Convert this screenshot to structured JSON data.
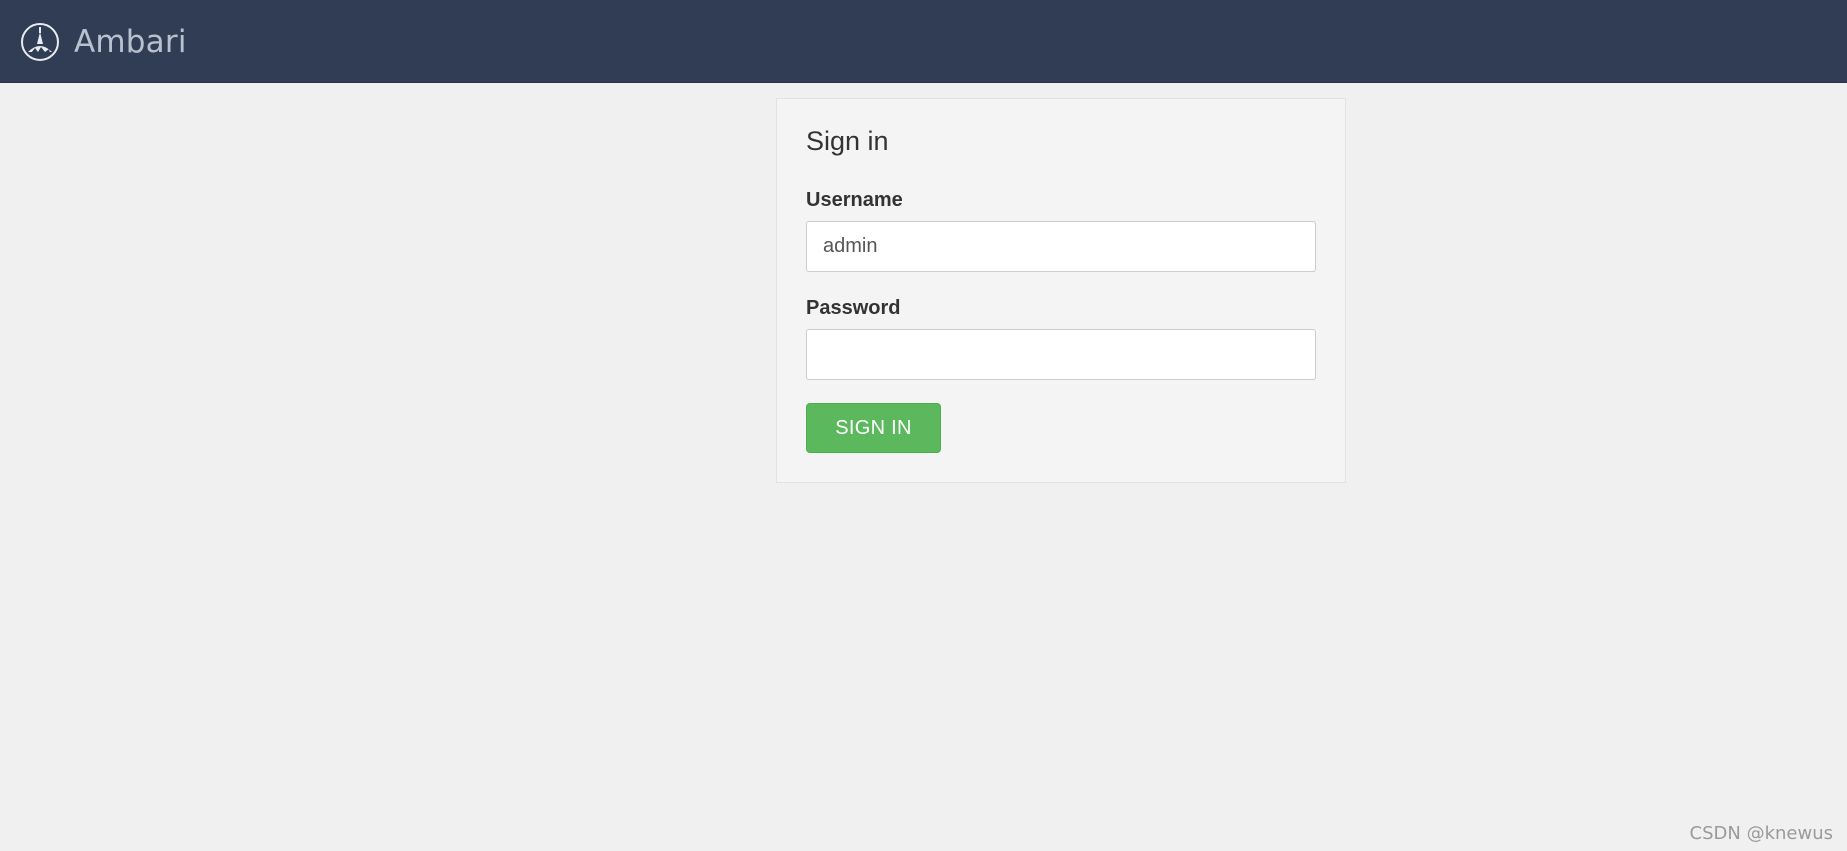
{
  "navbar": {
    "brand_name": "Ambari",
    "logo_icon": "ambari-logo-icon",
    "background_color": "#313d54"
  },
  "login": {
    "title": "Sign in",
    "username_label": "Username",
    "username_value": "admin",
    "password_label": "Password",
    "password_value": "",
    "submit_label": "SIGN IN",
    "submit_color": "#5cb85c"
  },
  "watermark": "CSDN @knewus"
}
